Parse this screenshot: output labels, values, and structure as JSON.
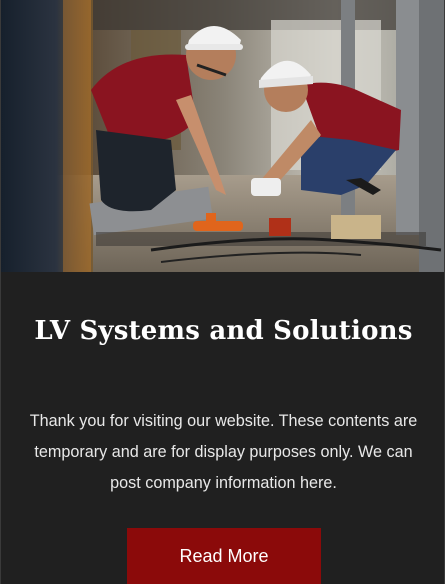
{
  "card": {
    "title": "LV Systems and Solutions",
    "description": "Thank you for visiting our website. These contents are temporary and are for display purposes only. We can post company information here.",
    "button_label": "Read More"
  },
  "colors": {
    "background": "#202020",
    "button": "#8b0a0a",
    "text": "#ffffff"
  }
}
